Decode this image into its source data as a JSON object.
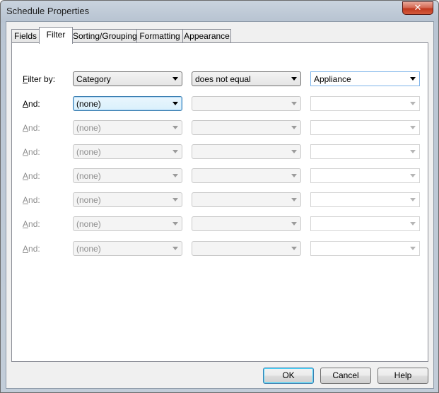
{
  "window": {
    "title": "Schedule Properties",
    "close_glyph": "✕"
  },
  "tabs": [
    {
      "label": "Fields",
      "active": false
    },
    {
      "label": "Filter",
      "active": true
    },
    {
      "label": "Sorting/Grouping",
      "active": false
    },
    {
      "label": "Formatting",
      "active": false
    },
    {
      "label": "Appearance",
      "active": false
    }
  ],
  "filter_rows": [
    {
      "label_mnemonic": "F",
      "label_rest": "ilter by:",
      "field": "Category",
      "condition": "does not equal",
      "value": "Appliance",
      "enabled": true
    },
    {
      "label_mnemonic": "A",
      "label_rest": "nd:",
      "field": "(none)",
      "condition": "",
      "value": "",
      "enabled": true
    },
    {
      "label_mnemonic": "A",
      "label_rest": "nd:",
      "field": "(none)",
      "condition": "",
      "value": "",
      "enabled": false
    },
    {
      "label_mnemonic": "A",
      "label_rest": "nd:",
      "field": "(none)",
      "condition": "",
      "value": "",
      "enabled": false
    },
    {
      "label_mnemonic": "A",
      "label_rest": "nd:",
      "field": "(none)",
      "condition": "",
      "value": "",
      "enabled": false
    },
    {
      "label_mnemonic": "A",
      "label_rest": "nd:",
      "field": "(none)",
      "condition": "",
      "value": "",
      "enabled": false
    },
    {
      "label_mnemonic": "A",
      "label_rest": "nd:",
      "field": "(none)",
      "condition": "",
      "value": "",
      "enabled": false
    },
    {
      "label_mnemonic": "A",
      "label_rest": "nd:",
      "field": "(none)",
      "condition": "",
      "value": "",
      "enabled": false
    }
  ],
  "buttons": {
    "ok": "OK",
    "cancel": "Cancel",
    "help": "Help"
  }
}
